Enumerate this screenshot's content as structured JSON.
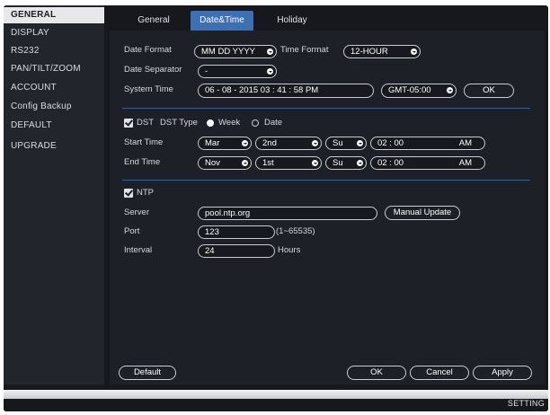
{
  "sidebar": {
    "items": [
      {
        "label": "GENERAL"
      },
      {
        "label": "DISPLAY"
      },
      {
        "label": "RS232"
      },
      {
        "label": "PAN/TILT/ZOOM"
      },
      {
        "label": "ACCOUNT"
      },
      {
        "label": "Config Backup"
      },
      {
        "label": "DEFAULT"
      },
      {
        "label": "UPGRADE"
      }
    ],
    "active": "GENERAL"
  },
  "tabs": [
    {
      "label": "General"
    },
    {
      "label": "Date&Time"
    },
    {
      "label": "Holiday"
    }
  ],
  "active_tab": "Date&Time",
  "date_format": {
    "label": "Date Format",
    "value": "MM DD YYYY"
  },
  "time_format": {
    "label": "Time Format",
    "value": "12-HOUR"
  },
  "date_separator": {
    "label": "Date Separator",
    "value": "-"
  },
  "system_time": {
    "label": "System Time",
    "value": "06 - 08 - 2015   03 : 41 : 58 PM",
    "timezone": "GMT-05:00",
    "ok_label": "OK"
  },
  "dst": {
    "checkbox_label": "DST",
    "type_label": "DST Type",
    "type_options": [
      "Week",
      "Date"
    ],
    "selected_type": "Week",
    "start": {
      "label": "Start Time",
      "month": "Mar",
      "week": "2nd",
      "day": "Su",
      "time": "02 :  00",
      "ampm": "AM"
    },
    "end": {
      "label": "End Time",
      "month": "Nov",
      "week": "1st",
      "day": "Su",
      "time": "02 :  00",
      "ampm": "AM"
    }
  },
  "ntp": {
    "checkbox_label": "NTP",
    "server_label": "Server",
    "server_value": "pool.ntp.org",
    "manual_update_label": "Manual Update",
    "port_label": "Port",
    "port_value": "123",
    "port_range": "(1~65535)",
    "interval_label": "Interval",
    "interval_value": "24",
    "interval_unit": "Hours"
  },
  "footer": {
    "default_label": "Default",
    "ok_label": "OK",
    "cancel_label": "Cancel",
    "apply_label": "Apply"
  },
  "status_bar": {
    "label": "SETTING"
  },
  "colors": {
    "accent": "#3c6fb3",
    "background": "#1d2026",
    "sidebar": "#22252c"
  }
}
